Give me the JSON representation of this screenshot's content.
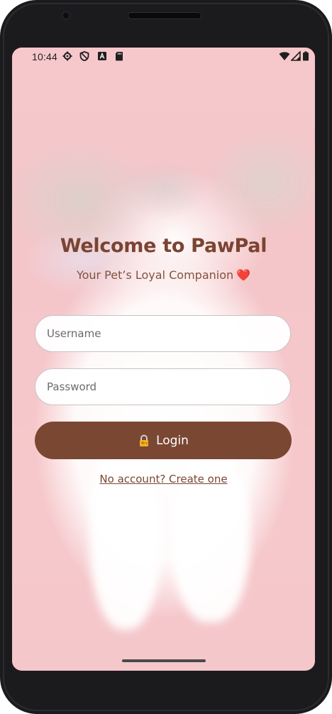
{
  "status_bar": {
    "time": "10:44",
    "left_icons": [
      "gear-icon",
      "shield-icon",
      "a-box-icon",
      "sd-card-icon"
    ],
    "right_icons": [
      "wifi-icon",
      "signal-icon",
      "battery-icon"
    ]
  },
  "screen": {
    "title": "Welcome to PawPal",
    "subtitle": "Your Pet’s Loyal Companion",
    "subtitle_emoji": "❤️",
    "username_placeholder": "Username",
    "password_placeholder": "Password",
    "login_label": "Login",
    "login_icon": "lock-with-key-icon",
    "create_account_link": "No account? Create one"
  },
  "colors": {
    "brand_brown": "#7a4733",
    "title_brown": "#7a4431",
    "heart_red": "#e52d3a"
  }
}
